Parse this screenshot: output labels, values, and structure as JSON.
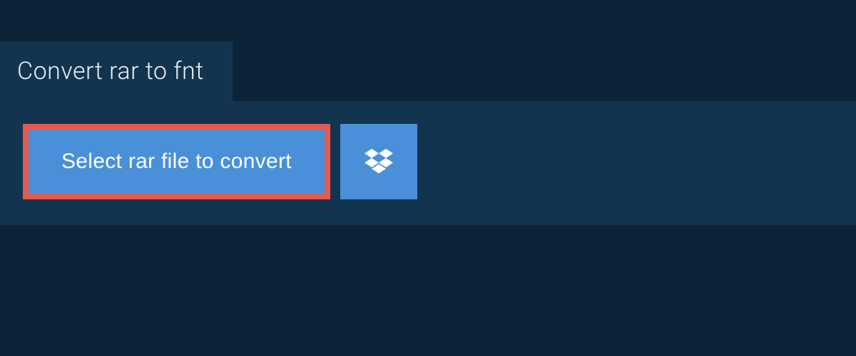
{
  "header": {
    "title": "Convert rar to fnt"
  },
  "actions": {
    "select_file_label": "Select rar file to convert"
  },
  "colors": {
    "background": "#0d2438",
    "panel": "#12344f",
    "button": "#4a90d9",
    "highlight_border": "#e55a4f",
    "text_light": "#e8eef4",
    "text_white": "#ffffff"
  }
}
